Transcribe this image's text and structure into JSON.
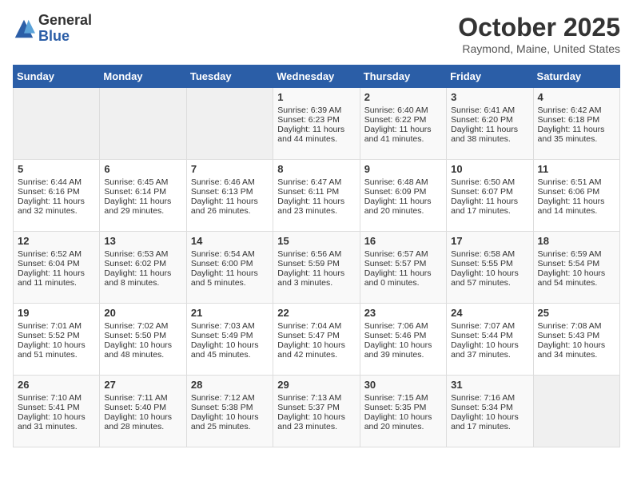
{
  "header": {
    "logo_general": "General",
    "logo_blue": "Blue",
    "month_title": "October 2025",
    "location": "Raymond, Maine, United States"
  },
  "weekdays": [
    "Sunday",
    "Monday",
    "Tuesday",
    "Wednesday",
    "Thursday",
    "Friday",
    "Saturday"
  ],
  "weeks": [
    [
      {
        "day": "",
        "empty": true
      },
      {
        "day": "",
        "empty": true
      },
      {
        "day": "",
        "empty": true
      },
      {
        "day": "1",
        "sunrise": "Sunrise: 6:39 AM",
        "sunset": "Sunset: 6:23 PM",
        "daylight": "Daylight: 11 hours and 44 minutes."
      },
      {
        "day": "2",
        "sunrise": "Sunrise: 6:40 AM",
        "sunset": "Sunset: 6:22 PM",
        "daylight": "Daylight: 11 hours and 41 minutes."
      },
      {
        "day": "3",
        "sunrise": "Sunrise: 6:41 AM",
        "sunset": "Sunset: 6:20 PM",
        "daylight": "Daylight: 11 hours and 38 minutes."
      },
      {
        "day": "4",
        "sunrise": "Sunrise: 6:42 AM",
        "sunset": "Sunset: 6:18 PM",
        "daylight": "Daylight: 11 hours and 35 minutes."
      }
    ],
    [
      {
        "day": "5",
        "sunrise": "Sunrise: 6:44 AM",
        "sunset": "Sunset: 6:16 PM",
        "daylight": "Daylight: 11 hours and 32 minutes."
      },
      {
        "day": "6",
        "sunrise": "Sunrise: 6:45 AM",
        "sunset": "Sunset: 6:14 PM",
        "daylight": "Daylight: 11 hours and 29 minutes."
      },
      {
        "day": "7",
        "sunrise": "Sunrise: 6:46 AM",
        "sunset": "Sunset: 6:13 PM",
        "daylight": "Daylight: 11 hours and 26 minutes."
      },
      {
        "day": "8",
        "sunrise": "Sunrise: 6:47 AM",
        "sunset": "Sunset: 6:11 PM",
        "daylight": "Daylight: 11 hours and 23 minutes."
      },
      {
        "day": "9",
        "sunrise": "Sunrise: 6:48 AM",
        "sunset": "Sunset: 6:09 PM",
        "daylight": "Daylight: 11 hours and 20 minutes."
      },
      {
        "day": "10",
        "sunrise": "Sunrise: 6:50 AM",
        "sunset": "Sunset: 6:07 PM",
        "daylight": "Daylight: 11 hours and 17 minutes."
      },
      {
        "day": "11",
        "sunrise": "Sunrise: 6:51 AM",
        "sunset": "Sunset: 6:06 PM",
        "daylight": "Daylight: 11 hours and 14 minutes."
      }
    ],
    [
      {
        "day": "12",
        "sunrise": "Sunrise: 6:52 AM",
        "sunset": "Sunset: 6:04 PM",
        "daylight": "Daylight: 11 hours and 11 minutes."
      },
      {
        "day": "13",
        "sunrise": "Sunrise: 6:53 AM",
        "sunset": "Sunset: 6:02 PM",
        "daylight": "Daylight: 11 hours and 8 minutes."
      },
      {
        "day": "14",
        "sunrise": "Sunrise: 6:54 AM",
        "sunset": "Sunset: 6:00 PM",
        "daylight": "Daylight: 11 hours and 5 minutes."
      },
      {
        "day": "15",
        "sunrise": "Sunrise: 6:56 AM",
        "sunset": "Sunset: 5:59 PM",
        "daylight": "Daylight: 11 hours and 3 minutes."
      },
      {
        "day": "16",
        "sunrise": "Sunrise: 6:57 AM",
        "sunset": "Sunset: 5:57 PM",
        "daylight": "Daylight: 11 hours and 0 minutes."
      },
      {
        "day": "17",
        "sunrise": "Sunrise: 6:58 AM",
        "sunset": "Sunset: 5:55 PM",
        "daylight": "Daylight: 10 hours and 57 minutes."
      },
      {
        "day": "18",
        "sunrise": "Sunrise: 6:59 AM",
        "sunset": "Sunset: 5:54 PM",
        "daylight": "Daylight: 10 hours and 54 minutes."
      }
    ],
    [
      {
        "day": "19",
        "sunrise": "Sunrise: 7:01 AM",
        "sunset": "Sunset: 5:52 PM",
        "daylight": "Daylight: 10 hours and 51 minutes."
      },
      {
        "day": "20",
        "sunrise": "Sunrise: 7:02 AM",
        "sunset": "Sunset: 5:50 PM",
        "daylight": "Daylight: 10 hours and 48 minutes."
      },
      {
        "day": "21",
        "sunrise": "Sunrise: 7:03 AM",
        "sunset": "Sunset: 5:49 PM",
        "daylight": "Daylight: 10 hours and 45 minutes."
      },
      {
        "day": "22",
        "sunrise": "Sunrise: 7:04 AM",
        "sunset": "Sunset: 5:47 PM",
        "daylight": "Daylight: 10 hours and 42 minutes."
      },
      {
        "day": "23",
        "sunrise": "Sunrise: 7:06 AM",
        "sunset": "Sunset: 5:46 PM",
        "daylight": "Daylight: 10 hours and 39 minutes."
      },
      {
        "day": "24",
        "sunrise": "Sunrise: 7:07 AM",
        "sunset": "Sunset: 5:44 PM",
        "daylight": "Daylight: 10 hours and 37 minutes."
      },
      {
        "day": "25",
        "sunrise": "Sunrise: 7:08 AM",
        "sunset": "Sunset: 5:43 PM",
        "daylight": "Daylight: 10 hours and 34 minutes."
      }
    ],
    [
      {
        "day": "26",
        "sunrise": "Sunrise: 7:10 AM",
        "sunset": "Sunset: 5:41 PM",
        "daylight": "Daylight: 10 hours and 31 minutes."
      },
      {
        "day": "27",
        "sunrise": "Sunrise: 7:11 AM",
        "sunset": "Sunset: 5:40 PM",
        "daylight": "Daylight: 10 hours and 28 minutes."
      },
      {
        "day": "28",
        "sunrise": "Sunrise: 7:12 AM",
        "sunset": "Sunset: 5:38 PM",
        "daylight": "Daylight: 10 hours and 25 minutes."
      },
      {
        "day": "29",
        "sunrise": "Sunrise: 7:13 AM",
        "sunset": "Sunset: 5:37 PM",
        "daylight": "Daylight: 10 hours and 23 minutes."
      },
      {
        "day": "30",
        "sunrise": "Sunrise: 7:15 AM",
        "sunset": "Sunset: 5:35 PM",
        "daylight": "Daylight: 10 hours and 20 minutes."
      },
      {
        "day": "31",
        "sunrise": "Sunrise: 7:16 AM",
        "sunset": "Sunset: 5:34 PM",
        "daylight": "Daylight: 10 hours and 17 minutes."
      },
      {
        "day": "",
        "empty": true
      }
    ]
  ]
}
